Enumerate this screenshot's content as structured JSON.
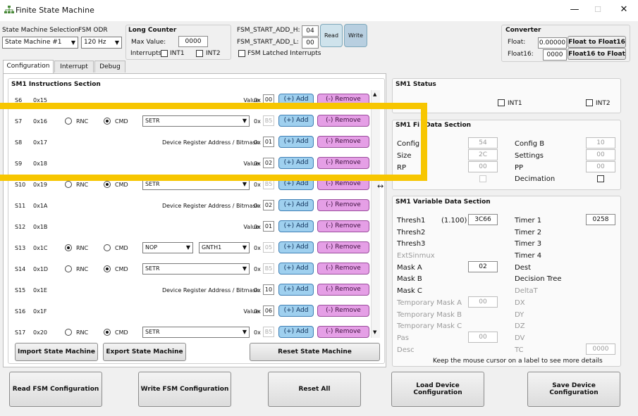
{
  "window": {
    "title": "Finite State Machine",
    "controls": {
      "minimize": "—",
      "maximize": "☐",
      "close": "✕"
    }
  },
  "toolbar": {
    "sm_selection_label": "State Machine Selection",
    "sm_selection_value": "State Machine #1",
    "odr_label": "FSM ODR",
    "odr_value": "120 Hz"
  },
  "long_counter": {
    "title": "Long Counter",
    "max_value_label": "Max Value:",
    "max_value": "0000",
    "interrupts_label": "Interrupts",
    "int1": "INT1",
    "int2": "INT2"
  },
  "fsm_start": {
    "h_label": "FSM_START_ADD_H:",
    "h_value": "04",
    "l_label": "FSM_START_ADD_L:",
    "l_value": "00",
    "read": "Read",
    "write": "Write",
    "latched_label": "FSM Latched Interrupts"
  },
  "converter": {
    "title": "Converter",
    "float_label": "Float:",
    "float_value": "0.00000",
    "float_btn": "Float to Float16",
    "float16_label": "Float16:",
    "float16_value": "0000",
    "float16_btn": "Float16 to Float"
  },
  "tabs": [
    "Configuration",
    "Interrupt",
    "Debug"
  ],
  "instructions": {
    "title": "SM1 Instructions Section",
    "rows": [
      {
        "s": "S6",
        "addr": "0x15",
        "rnc": "",
        "cmd": "",
        "op1": "",
        "op2": "",
        "label": "Value:",
        "hex": "00",
        "add": "(+) Add",
        "remove": "(-) Remove"
      },
      {
        "s": "S7",
        "addr": "0x16",
        "rnc": "RNC",
        "cmd": "CMD",
        "op1": "SETR",
        "op2": "",
        "label": "",
        "hex": "B5",
        "add": "(+) Add",
        "remove": "(-) Remove"
      },
      {
        "s": "S8",
        "addr": "0x17",
        "rnc": "",
        "cmd": "",
        "op1": "",
        "op2": "",
        "label": "Device Register Address / Bitmask:",
        "hex": "01",
        "add": "(+) Add",
        "remove": "(-) Remove"
      },
      {
        "s": "S9",
        "addr": "0x18",
        "rnc": "",
        "cmd": "",
        "op1": "",
        "op2": "",
        "label": "Value:",
        "hex": "02",
        "add": "(+) Add",
        "remove": "(-) Remove"
      },
      {
        "s": "S10",
        "addr": "0x19",
        "rnc": "RNC",
        "cmd": "CMD",
        "op1": "SETR",
        "op2": "",
        "label": "",
        "hex": "B5",
        "add": "(+) Add",
        "remove": "(-) Remove"
      },
      {
        "s": "S11",
        "addr": "0x1A",
        "rnc": "",
        "cmd": "",
        "op1": "",
        "op2": "",
        "label": "Device Register Address / Bitmask:",
        "hex": "02",
        "add": "(+) Add",
        "remove": "(-) Remove"
      },
      {
        "s": "S12",
        "addr": "0x1B",
        "rnc": "",
        "cmd": "",
        "op1": "",
        "op2": "",
        "label": "Value:",
        "hex": "01",
        "add": "(+) Add",
        "remove": "(-) Remove"
      },
      {
        "s": "S13",
        "addr": "0x1C",
        "rnc": "RNC",
        "cmd": "CMD",
        "op1": "NOP",
        "op2": "GNTH1",
        "label": "",
        "hex": "05",
        "add": "(+) Add",
        "remove": "(-) Remove"
      },
      {
        "s": "S14",
        "addr": "0x1D",
        "rnc": "RNC",
        "cmd": "CMD",
        "op1": "SETR",
        "op2": "",
        "label": "",
        "hex": "B5",
        "add": "(+) Add",
        "remove": "(-) Remove"
      },
      {
        "s": "S15",
        "addr": "0x1E",
        "rnc": "",
        "cmd": "",
        "op1": "",
        "op2": "",
        "label": "Device Register Address / Bitmask:",
        "hex": "10",
        "add": "(+) Add",
        "remove": "(-) Remove"
      },
      {
        "s": "S16",
        "addr": "0x1F",
        "rnc": "",
        "cmd": "",
        "op1": "",
        "op2": "",
        "label": "Value:",
        "hex": "06",
        "add": "(+) Add",
        "remove": "(-) Remove"
      },
      {
        "s": "S17",
        "addr": "0x20",
        "rnc": "RNC",
        "cmd": "CMD",
        "op1": "SETR",
        "op2": "",
        "label": "",
        "hex": "B5",
        "add": "(+) Add",
        "remove": "(-) Remove"
      }
    ],
    "hex_prefix": "0x"
  },
  "sm_buttons": {
    "import": "Import State Machine",
    "export": "Export State Machine",
    "reset": "Reset State Machine"
  },
  "status": {
    "title": "SM1 Status",
    "int1": "INT1",
    "int2": "INT2"
  },
  "fixed": {
    "title_visible": "SM1 Fi",
    "title_rest": "Data Section",
    "config_label": "Config",
    "config_value": "54",
    "size_label": "Size",
    "size_value": "2C",
    "rp_label": "RP",
    "rp_value": "00",
    "configb_label": "Config B",
    "configb_value": "10",
    "settings_label": "Settings",
    "settings_value": "00",
    "pp_label": "PP",
    "pp_value": "00",
    "decimation_label": "Decimation"
  },
  "variable": {
    "title": "SM1 Variable Data Section",
    "thresh1": "Thresh1",
    "thresh1_extra": "(1.100)",
    "thresh1_value": "3C66",
    "thresh2": "Thresh2",
    "thresh3": "Thresh3",
    "extsinmux": "ExtSinmux",
    "maska": "Mask A",
    "maska_value": "02",
    "maskb": "Mask B",
    "maskc": "Mask C",
    "tmaska": "Temporary Mask A",
    "tmaska_value": "00",
    "tmaskb": "Temporary Mask B",
    "tmaskc": "Temporary Mask C",
    "pas": "Pas",
    "pas_value": "00",
    "desc": "Desc",
    "timer1": "Timer 1",
    "timer1_value": "0258",
    "timer2": "Timer 2",
    "timer3": "Timer 3",
    "timer4": "Timer 4",
    "dest": "Dest",
    "decision_tree": "Decision Tree",
    "deltat": "DeltaT",
    "dx": "DX",
    "dy": "DY",
    "dz": "DZ",
    "dv": "DV",
    "tc": "TC",
    "tc_value": "0000",
    "hint": "Keep the mouse cursor on a label to see more details"
  },
  "bottom": {
    "read": "Read FSM Configuration",
    "write": "Write FSM Configuration",
    "reset_all": "Reset All",
    "load_line1": "Load Device",
    "load_line2": "Configuration",
    "save_line1": "Save Device",
    "save_line2": "Configuration"
  },
  "colors": {
    "highlight": "#f7c600",
    "add_button": "#9fd0ef",
    "remove_button": "#e59fe6"
  }
}
